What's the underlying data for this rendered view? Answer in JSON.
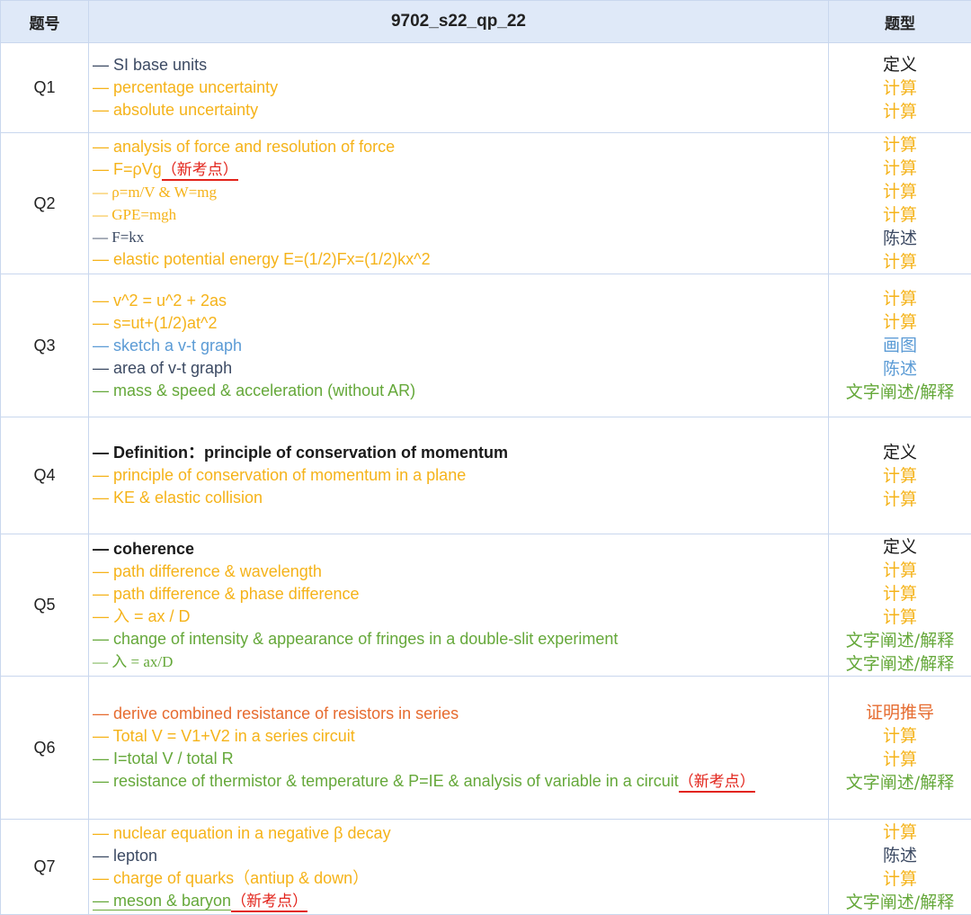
{
  "header": {
    "col_number": "题号",
    "col_title": "9702_s22_qp_22",
    "col_type": "题型"
  },
  "colors": {
    "black": "#1a1a1a",
    "navy": "#3c4a63",
    "orange": "#f5b31a",
    "blue": "#5b9bd5",
    "green": "#65a83a",
    "red": "#e66b2f",
    "new_marker": "#e2231a"
  },
  "rows": [
    {
      "q": "Q1",
      "topics": [
        {
          "text": "— SI base units",
          "color": "navy"
        },
        {
          "text": "— percentage uncertainty",
          "color": "orange"
        },
        {
          "text": "— absolute uncertainty",
          "color": "orange"
        }
      ],
      "types": [
        {
          "text": "定义",
          "color": "black"
        },
        {
          "text": "计算",
          "color": "orange"
        },
        {
          "text": "计算",
          "color": "orange"
        }
      ]
    },
    {
      "q": "Q2",
      "topics": [
        {
          "text": "— analysis of force and resolution of force",
          "color": "orange"
        },
        {
          "text": "— F=ρVg",
          "color": "orange",
          "new": "（新考点）"
        },
        {
          "text": "— ρ=m/V & W=mg",
          "color": "orange",
          "serif": true
        },
        {
          "text": "—  GPE=mgh",
          "color": "orange",
          "serif": true
        },
        {
          "text": "—  F=kx",
          "color": "navy",
          "serif": true
        },
        {
          "text": "— elastic potential energy E=(1/2)Fx=(1/2)kx^2",
          "color": "orange"
        }
      ],
      "types": [
        {
          "text": "计算",
          "color": "orange"
        },
        {
          "text": "计算",
          "color": "orange"
        },
        {
          "text": "计算",
          "color": "orange"
        },
        {
          "text": "计算",
          "color": "orange"
        },
        {
          "text": "陈述",
          "color": "navy"
        },
        {
          "text": "计算",
          "color": "orange"
        }
      ]
    },
    {
      "q": "Q3",
      "topics": [
        {
          "text": "— v^2 = u^2 + 2as",
          "color": "orange"
        },
        {
          "text": "— s=ut+(1/2)at^2",
          "color": "orange"
        },
        {
          "text": "— sketch a v-t graph",
          "color": "blue"
        },
        {
          "text": "— area of v-t graph",
          "color": "navy"
        },
        {
          "text": "— mass & speed & acceleration (without AR)",
          "color": "green"
        }
      ],
      "types": [
        {
          "text": "计算",
          "color": "orange"
        },
        {
          "text": "计算",
          "color": "orange"
        },
        {
          "text": "画图",
          "color": "blue"
        },
        {
          "text": "陈述",
          "color": "blue"
        },
        {
          "text": "文字阐述/解释",
          "color": "green"
        }
      ]
    },
    {
      "q": "Q4",
      "topics": [
        {
          "text": "— Definition：principle of conservation of momentum",
          "color": "black",
          "bold": true
        },
        {
          "text": "— principle of conservation of momentum in a plane",
          "color": "orange"
        },
        {
          "text": "— KE & elastic collision",
          "color": "orange"
        }
      ],
      "types": [
        {
          "text": "定义",
          "color": "black"
        },
        {
          "text": "计算",
          "color": "orange"
        },
        {
          "text": "计算",
          "color": "orange"
        }
      ]
    },
    {
      "q": "Q5",
      "topics": [
        {
          "text": "— coherence",
          "color": "black",
          "bold": true
        },
        {
          "text": "— path difference & wavelength",
          "color": "orange"
        },
        {
          "text": "— path difference & phase difference",
          "color": "orange"
        },
        {
          "text": "— 入 = ax / D",
          "color": "orange"
        },
        {
          "text": "— change of intensity & appearance of fringes in a double-slit experiment",
          "color": "green"
        },
        {
          "text": "— 入 = ax/D",
          "color": "green",
          "serif": true
        }
      ],
      "types": [
        {
          "text": "定义",
          "color": "black"
        },
        {
          "text": "计算",
          "color": "orange"
        },
        {
          "text": "计算",
          "color": "orange"
        },
        {
          "text": "计算",
          "color": "orange"
        },
        {
          "text": "文字阐述/解释",
          "color": "green"
        },
        {
          "text": "文字阐述/解释",
          "color": "green"
        }
      ]
    },
    {
      "q": "Q6",
      "topics": [
        {
          "text": "— derive  combined resistance of resistors in series",
          "color": "red"
        },
        {
          "text": "— Total V = V1+V2 in a series circuit",
          "color": "orange"
        },
        {
          "text": "— I=total V / total R",
          "color": "green"
        },
        {
          "text": "— resistance of thermistor & temperature & P=IE & analysis of variable in a circuit",
          "color": "green",
          "new": "（新考点）"
        }
      ],
      "types": [
        {
          "text": "证明推导",
          "color": "red"
        },
        {
          "text": "计算",
          "color": "orange"
        },
        {
          "text": "计算",
          "color": "orange"
        },
        {
          "text": "文字阐述/解释",
          "color": "green"
        }
      ]
    },
    {
      "q": "Q7",
      "topics": [
        {
          "text": "— nuclear equation in a negative β decay",
          "color": "orange"
        },
        {
          "text": "— lepton",
          "color": "navy"
        },
        {
          "text": "— charge of quarks（antiup & down）",
          "color": "orange"
        },
        {
          "text": "— meson & baryon",
          "color": "green",
          "new": "（新考点）",
          "underline": true
        }
      ],
      "types": [
        {
          "text": "计算",
          "color": "orange"
        },
        {
          "text": "陈述",
          "color": "navy"
        },
        {
          "text": "计算",
          "color": "orange"
        },
        {
          "text": "文字阐述/解释",
          "color": "green"
        }
      ]
    }
  ]
}
